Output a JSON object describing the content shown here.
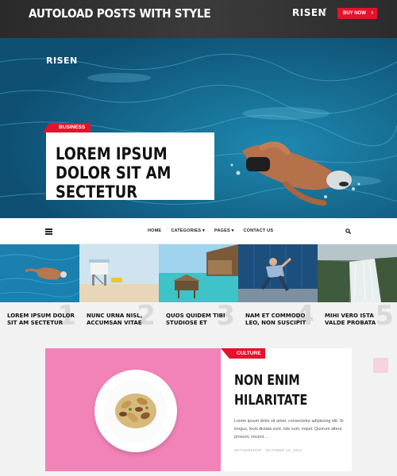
{
  "header": {
    "title": "AUTOLOAD POSTS WITH STYLE",
    "brand": "RISEN",
    "separator": "/",
    "buy_button": "BUY NOW",
    "buy_chevron": "›"
  },
  "hero": {
    "logo": "RISEN",
    "tag": "BUSINESS",
    "headline": "LOREM IPSUM DOLOR SIT AM SECTETUR"
  },
  "nav": {
    "links": [
      "HOME",
      "CATEGORIES",
      "PAGES",
      "CONTACT US"
    ],
    "dropdown_marker": "▾"
  },
  "tiles": [
    {
      "num": "1",
      "caption": "LOREM IPSUM DOLOR SIT AM SECTETUR"
    },
    {
      "num": "2",
      "caption": "NUNC URNA NISL, ACCUMSAN VITAE"
    },
    {
      "num": "3",
      "caption": "QUOS QUIDEM TIBI STUDIOSE ET"
    },
    {
      "num": "4",
      "caption": "NAM ET COMMODO LEO, NON SUSCIPIT"
    },
    {
      "num": "5",
      "caption": "MIHI VERO ISTA VALDE PROBATA"
    }
  ],
  "feature": {
    "tag": "CULTURE",
    "headline": "NON ENIM HILARITATE",
    "excerpt": "Lorem ipsum dolor sit amet, consectetur adipiscing elit. Si longus, levis dictata sunt. Iste sum, inquit. Quorum altera prosunt, nocent ...",
    "meta": "BYTHEMSHOP  ·  OCTOBER 18, 2018"
  },
  "colors": {
    "accent": "#e5122b",
    "pink": "#f283b8",
    "topbar": "#2f2f2f"
  }
}
